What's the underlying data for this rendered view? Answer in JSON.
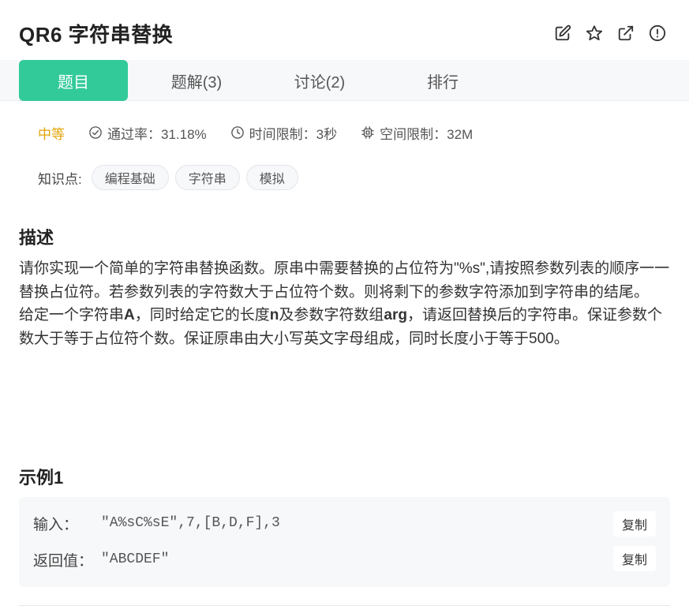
{
  "problem": {
    "title": "QR6  字符串替换"
  },
  "header_icons": [
    "edit-icon",
    "star-icon",
    "share-icon",
    "info-icon"
  ],
  "tabs": [
    {
      "label": "题目",
      "active": true
    },
    {
      "label": "题解(3)",
      "active": false
    },
    {
      "label": "讨论(2)",
      "active": false
    },
    {
      "label": "排行",
      "active": false
    }
  ],
  "meta": {
    "difficulty": "中等",
    "pass_rate": "通过率：31.18%",
    "time_limit": "时间限制：3秒",
    "space_limit": "空间限制：32M"
  },
  "knowledge": {
    "label": "知识点:",
    "tags": [
      "编程基础",
      "字符串",
      "模拟"
    ]
  },
  "description": {
    "title": "描述",
    "p1": "请你实现一个简单的字符串替换函数。原串中需要替换的占位符为\"%s\",请按照参数列表的顺序一一替换占位符。若参数列表的字符数大于占位符个数。则将剩下的参数字符添加到字符串的结尾。",
    "p2_a": "给定一个字符串",
    "p2_var_a": "A",
    "p2_b": "，同时给定它的长度",
    "p2_var_n": "n",
    "p2_c": "及参数字符数组",
    "p2_var_arg": "arg",
    "p2_d": "，请返回替换后的字符串。保证参数个数大于等于占位符个数。保证原串由大小写英文字母组成，同时长度小于等于500。"
  },
  "example": {
    "title": "示例1",
    "input_label": "输入：",
    "input_value": "\"A%sC%sE\",7,[B,D,F],3",
    "output_label": "返回值：",
    "output_value": "\"ABCDEF\"",
    "copy_label": "复制"
  },
  "colors": {
    "accent": "#32ca99",
    "difficulty": "#e2a50a"
  }
}
